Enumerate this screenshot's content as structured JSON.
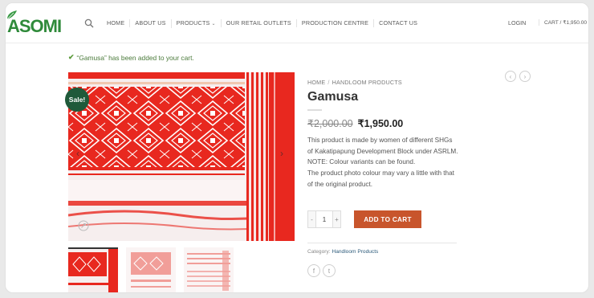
{
  "header": {
    "logo_text": "ASOMI",
    "nav": [
      "HOME",
      "ABOUT US",
      "PRODUCTS",
      "OUR RETAIL OUTLETS",
      "PRODUCTION CENTRE",
      "CONTACT US"
    ],
    "login": "LOGIN",
    "cart": "CART / ₹1,950.00"
  },
  "notice": {
    "text": "“Gamusa” has been added to your cart."
  },
  "gallery": {
    "sale_badge": "Sale!"
  },
  "product": {
    "breadcrumb": [
      "HOME",
      "HANDLOOM PRODUCTS"
    ],
    "title": "Gamusa",
    "old_price": "₹2,000.00",
    "new_price": "₹1,950.00",
    "description": [
      "This product is made by women of different SHGs of Kakatipapung Development Block under ASRLM.",
      "NOTE: Colour variants can be found.",
      "The product photo colour may vary a little with that of the original product."
    ],
    "quantity": "1",
    "qty_minus": "-",
    "qty_plus": "+",
    "add_to_cart": "ADD TO CART",
    "category_label": "Category:",
    "category_value": "Handloom Products"
  },
  "colors": {
    "accent": "#c8552c",
    "sale_badge": "#1f5a3a",
    "notice_green": "#4a7a3a",
    "fabric_red": "#e02424"
  },
  "icons": [
    "search-icon",
    "check-icon",
    "zoom-icon",
    "facebook-icon",
    "twitter-icon",
    "prev-icon",
    "next-icon"
  ]
}
